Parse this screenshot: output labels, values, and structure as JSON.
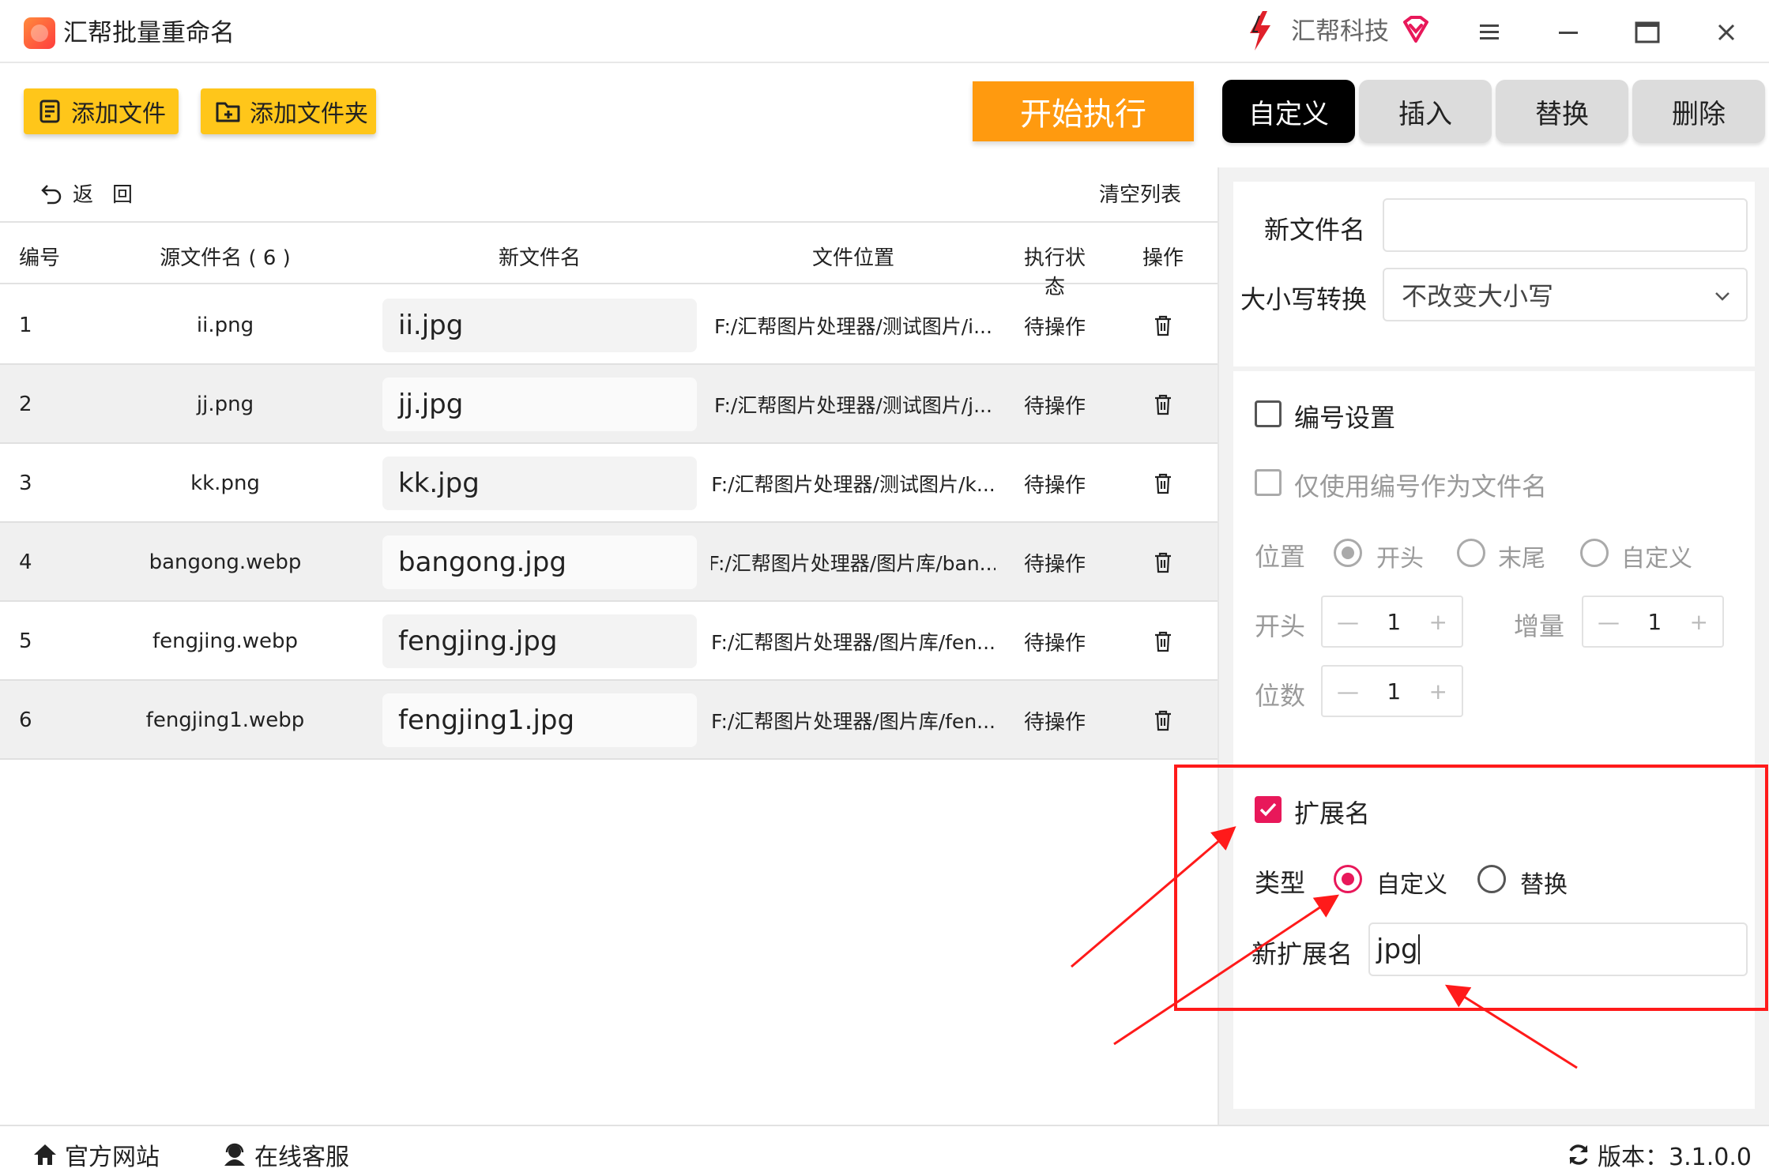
{
  "window": {
    "title": "汇帮批量重命名",
    "brand": "汇帮科技"
  },
  "toolbar": {
    "add_file": "添加文件",
    "add_folder": "添加文件夹",
    "start": "开始执行"
  },
  "tabs": [
    {
      "label": "自定义",
      "active": true
    },
    {
      "label": "插入",
      "active": false
    },
    {
      "label": "替换",
      "active": false
    },
    {
      "label": "删除",
      "active": false
    }
  ],
  "list_actions": {
    "back": "返回",
    "clear": "清空列表"
  },
  "table": {
    "headers": {
      "no": "编号",
      "source": "源文件名 ( 6 )",
      "new_name": "新文件名",
      "location": "文件位置",
      "status": "执行状态",
      "operation": "操作"
    },
    "rows": [
      {
        "no": "1",
        "source": "ii.png",
        "new_name": "ii.jpg",
        "location": "F:/汇帮图片处理器/测试图片/i...",
        "status": "待操作"
      },
      {
        "no": "2",
        "source": "jj.png",
        "new_name": "jj.jpg",
        "location": "F:/汇帮图片处理器/测试图片/j...",
        "status": "待操作"
      },
      {
        "no": "3",
        "source": "kk.png",
        "new_name": "kk.jpg",
        "location": "F:/汇帮图片处理器/测试图片/k...",
        "status": "待操作"
      },
      {
        "no": "4",
        "source": "bangong.webp",
        "new_name": "bangong.jpg",
        "location": "F:/汇帮图片处理器/图片库/ban...",
        "status": "待操作"
      },
      {
        "no": "5",
        "source": "fengjing.webp",
        "new_name": "fengjing.jpg",
        "location": "F:/汇帮图片处理器/图片库/fen...",
        "status": "待操作"
      },
      {
        "no": "6",
        "source": "fengjing1.webp",
        "new_name": "fengjing1.jpg",
        "location": "F:/汇帮图片处理器/图片库/fen...",
        "status": "待操作"
      }
    ]
  },
  "panel": {
    "new_filename_label": "新文件名",
    "new_filename_value": "",
    "case_label": "大小写转换",
    "case_value": "不改变大小写",
    "numbering": {
      "label": "编号设置",
      "checked": false,
      "only_number_label": "仅使用编号作为文件名",
      "position_label": "位置",
      "positions": [
        "开头",
        "末尾",
        "自定义"
      ],
      "selected_position": "开头",
      "start_label": "开头",
      "start_value": "1",
      "increment_label": "增量",
      "increment_value": "1",
      "digits_label": "位数",
      "digits_value": "1"
    },
    "extension": {
      "label": "扩展名",
      "checked": true,
      "type_label": "类型",
      "types": [
        "自定义",
        "替换"
      ],
      "selected_type": "自定义",
      "new_ext_label": "新扩展名",
      "new_ext_value": "jpg"
    }
  },
  "footer": {
    "official_site": "官方网站",
    "online_support": "在线客服",
    "version": "版本：3.1.0.0"
  },
  "colors": {
    "accent_yellow": "#ffc61a",
    "start_orange": "#ff9a0f",
    "check_pink": "#e8185a",
    "annotation_red": "#ff1a1a"
  }
}
